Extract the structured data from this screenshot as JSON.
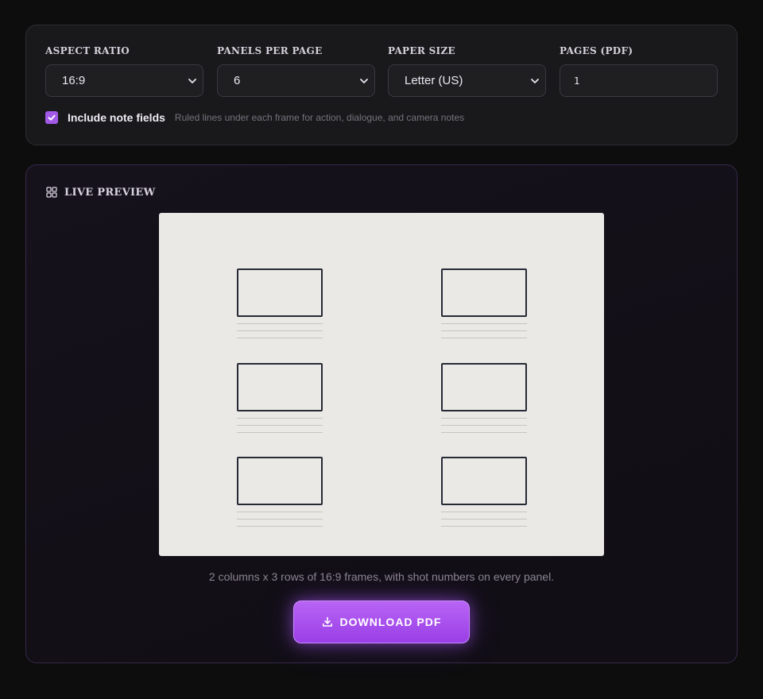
{
  "settings": {
    "aspect_ratio": {
      "label": "ASPECT RATIO",
      "value": "16:9"
    },
    "panels_per_page": {
      "label": "PANELS PER PAGE",
      "value": "6"
    },
    "paper_size": {
      "label": "PAPER SIZE",
      "value": "Letter (US)"
    },
    "pages": {
      "label": "PAGES (PDF)",
      "value": "1"
    },
    "note_fields": {
      "checked": true,
      "label": "Include note fields",
      "hint": "Ruled lines under each frame for action, dialogue, and camera notes"
    }
  },
  "preview": {
    "title": "LIVE PREVIEW",
    "icon": "grid-icon",
    "layout": {
      "columns": 2,
      "rows": 3,
      "note_lines_per_panel": 3
    },
    "caption": "2 columns x 3 rows of 16:9 frames, with shot numbers on every panel.",
    "download_label": "DOWNLOAD PDF",
    "download_icon": "download-icon"
  },
  "colors": {
    "accent": "#a259e6",
    "paper": "#ebe9e5",
    "frame_stroke": "#252a35"
  }
}
